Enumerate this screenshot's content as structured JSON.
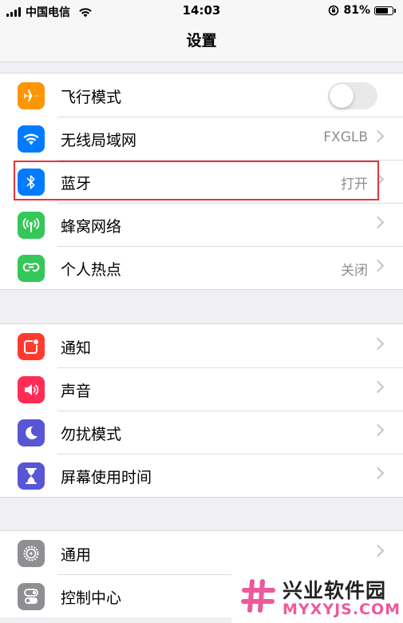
{
  "status_bar": {
    "carrier": "中国电信",
    "time": "14:03",
    "battery_percent": "81%",
    "battery_level": 0.81
  },
  "nav": {
    "title": "设置"
  },
  "groups": [
    {
      "rows": [
        {
          "label": "飞行模式",
          "icon": "airplane-icon",
          "icon_color": "#ff9500",
          "control": "toggle",
          "toggle_on": false
        },
        {
          "label": "无线局域网",
          "icon": "wifi-icon",
          "icon_color": "#007aff",
          "value": "FXGLB"
        },
        {
          "label": "蓝牙",
          "icon": "bluetooth-icon",
          "icon_color": "#007aff",
          "value": "打开",
          "highlighted": true
        },
        {
          "label": "蜂窝网络",
          "icon": "antenna-icon",
          "icon_color": "#34c759"
        },
        {
          "label": "个人热点",
          "icon": "hotspot-icon",
          "icon_color": "#34c759",
          "value": "关闭"
        }
      ]
    },
    {
      "rows": [
        {
          "label": "通知",
          "icon": "notifications-icon",
          "icon_color": "#ff3b30"
        },
        {
          "label": "声音",
          "icon": "speaker-icon",
          "icon_color": "#ff2d55"
        },
        {
          "label": "勿扰模式",
          "icon": "moon-icon",
          "icon_color": "#5856d6"
        },
        {
          "label": "屏幕使用时间",
          "icon": "hourglass-icon",
          "icon_color": "#5856d6"
        }
      ]
    },
    {
      "rows": [
        {
          "label": "通用",
          "icon": "gear-icon",
          "icon_color": "#8e8e93"
        },
        {
          "label": "控制中心",
          "icon": "toggles-icon",
          "icon_color": "#8e8e93"
        }
      ]
    }
  ],
  "watermark": {
    "title": "兴业软件园",
    "url": "MYXYJS.COM",
    "accent": "#ec5a9c"
  }
}
